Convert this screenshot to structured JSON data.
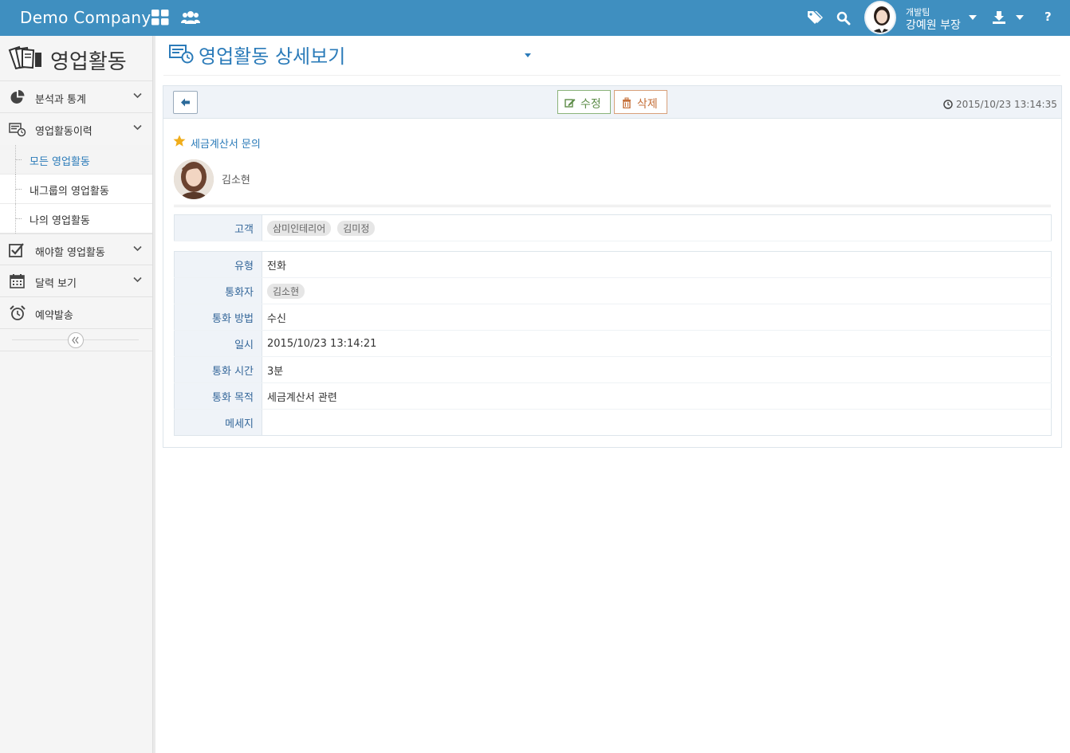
{
  "topbar": {
    "brand": "Demo Company",
    "user_team": "개발팀",
    "user_name": "강예원 부장",
    "help_label": "?"
  },
  "sidebar": {
    "title": "영업활동",
    "items": [
      {
        "label": "분석과 통계"
      },
      {
        "label": "영업활동이력"
      },
      {
        "label": "해야할 영업활동"
      },
      {
        "label": "달력 보기"
      },
      {
        "label": "예약발송"
      }
    ],
    "sub_items": [
      {
        "label": "모든 영업활동",
        "active": true
      },
      {
        "label": "내그룹의 영업활동"
      },
      {
        "label": "나의 영업활동"
      }
    ]
  },
  "main": {
    "page_title": "영업활동 상세보기",
    "edit_label": "수정",
    "delete_label": "삭제",
    "timestamp": "2015/10/23 13:14:35",
    "subject": "세금계산서 문의",
    "author": "김소현"
  },
  "customer_table": {
    "label": "고객",
    "tags": [
      "삼미인테리어",
      "김미정"
    ]
  },
  "detail_table": {
    "type_label": "유형",
    "type_value": "전화",
    "caller_label": "통화자",
    "caller_tag": "김소현",
    "method_label": "통화 방법",
    "method_value": "수신",
    "datetime_label": "일시",
    "datetime_value": "2015/10/23 13:14:21",
    "duration_label": "통화 시간",
    "duration_value": "3분",
    "purpose_label": "통화 목적",
    "purpose_value": "세금계산서 관련",
    "message_label": "메세지",
    "message_value": ""
  },
  "colors": {
    "topbar": "#3f8fc0",
    "accent": "#2b7bb9",
    "edit": "#5d8c48",
    "delete": "#c56f38"
  }
}
